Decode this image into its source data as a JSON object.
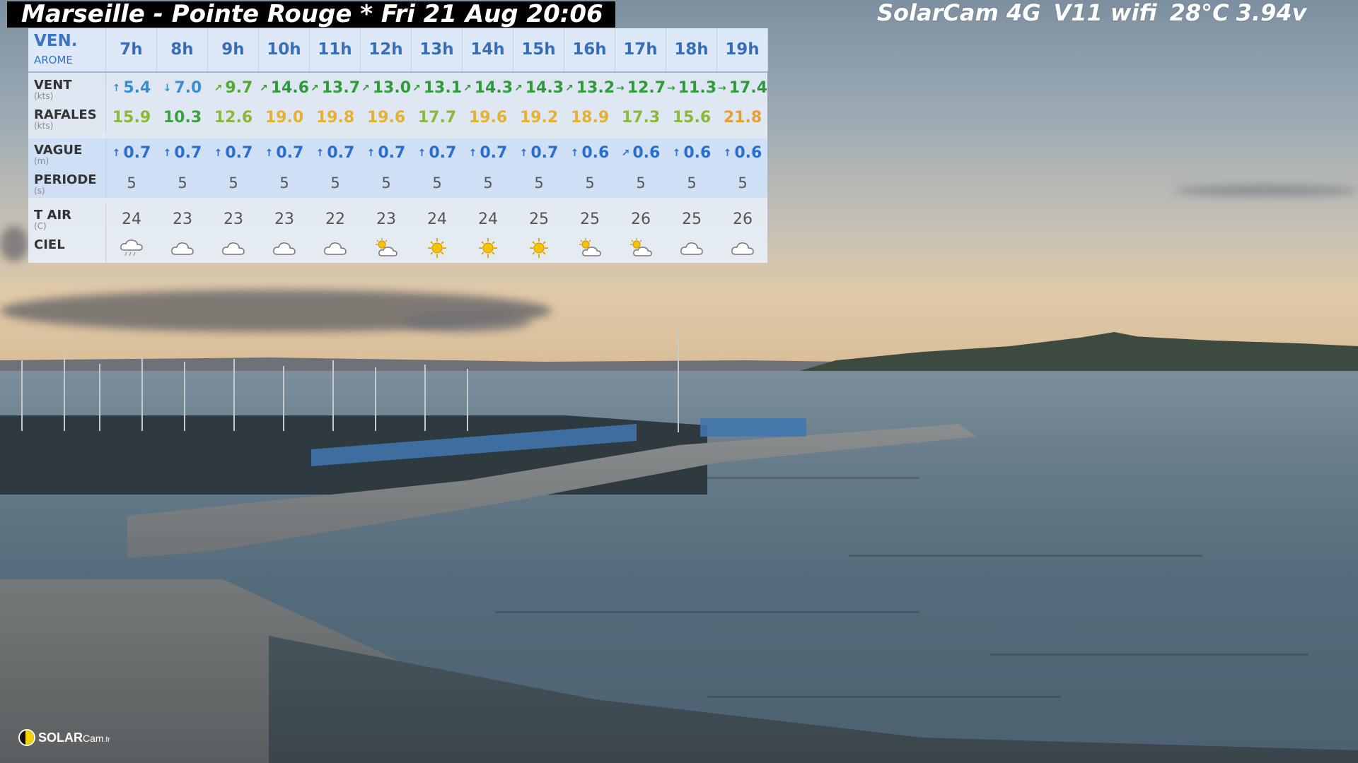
{
  "header": {
    "location_title": "Marseille - Pointe Rouge * Fri 21 Aug 20:06",
    "camera_model": "SolarCam 4G",
    "firmware": "V11 wifi",
    "temperature": "28°C",
    "voltage": "3.94v"
  },
  "forecast": {
    "day_label": "VEN.",
    "model_label": "AROME",
    "hours": [
      "7h",
      "8h",
      "9h",
      "10h",
      "11h",
      "12h",
      "13h",
      "14h",
      "15h",
      "16h",
      "17h",
      "18h",
      "19h"
    ],
    "rows": {
      "wind": {
        "label": "VENT",
        "unit": "(kts)",
        "values": [
          "5.4",
          "7.0",
          "9.7",
          "14.6",
          "13.7",
          "13.0",
          "13.1",
          "14.3",
          "14.3",
          "13.2",
          "12.7",
          "11.3",
          "17.4"
        ],
        "colors": [
          "#3a8fd0",
          "#3a8fd0",
          "#55a830",
          "#2f9a3a",
          "#2f9a3a",
          "#2f9a3a",
          "#2f9a3a",
          "#2f9a3a",
          "#2f9a3a",
          "#2f9a3a",
          "#2f9a3a",
          "#2f9a3a",
          "#2f9a3a"
        ],
        "arrows": [
          "↑",
          "↓",
          "↗",
          "↗",
          "↗",
          "↗",
          "↗",
          "↗",
          "↗",
          "↗",
          "→",
          "→",
          "→"
        ]
      },
      "gusts": {
        "label": "RAFALES",
        "unit": "(kts)",
        "values": [
          "15.9",
          "10.3",
          "12.6",
          "19.0",
          "19.8",
          "19.6",
          "17.7",
          "19.6",
          "19.2",
          "18.9",
          "17.3",
          "15.6",
          "21.8"
        ],
        "colors": [
          "#8ab83a",
          "#3aa040",
          "#8ab83a",
          "#e6b030",
          "#e6b030",
          "#e6b030",
          "#8ab83a",
          "#e6b030",
          "#e6b030",
          "#e6b030",
          "#8ab83a",
          "#8ab83a",
          "#e6a030"
        ]
      },
      "wave": {
        "label": "VAGUE",
        "unit": "(m)",
        "values": [
          "0.7",
          "0.7",
          "0.7",
          "0.7",
          "0.7",
          "0.7",
          "0.7",
          "0.7",
          "0.7",
          "0.6",
          "0.6",
          "0.6",
          "0.6"
        ],
        "arrows": [
          "↑",
          "↑",
          "↑",
          "↑",
          "↑",
          "↑",
          "↑",
          "↑",
          "↑",
          "↑",
          "↗",
          "↑",
          "↑"
        ]
      },
      "period": {
        "label": "PERIODE",
        "unit": "(s)",
        "values": [
          "5",
          "5",
          "5",
          "5",
          "5",
          "5",
          "5",
          "5",
          "5",
          "5",
          "5",
          "5",
          "5"
        ]
      },
      "air": {
        "label": "T AIR",
        "unit": "(C)",
        "values": [
          "24",
          "23",
          "23",
          "23",
          "22",
          "23",
          "24",
          "24",
          "25",
          "25",
          "26",
          "25",
          "26"
        ]
      },
      "sky": {
        "label": "CIEL",
        "icons": [
          "drizzle-icon",
          "cloud-icon",
          "cloud-icon",
          "cloud-icon",
          "cloud-icon",
          "sun-cloud-icon",
          "sun-icon",
          "sun-icon",
          "sun-icon",
          "sun-cloud-icon",
          "sun-cloud-icon",
          "cloud-icon",
          "cloud-icon"
        ]
      }
    }
  },
  "logo": {
    "brand": "SOLAR",
    "brand_suffix": "Cam",
    "domain": ".fr"
  }
}
